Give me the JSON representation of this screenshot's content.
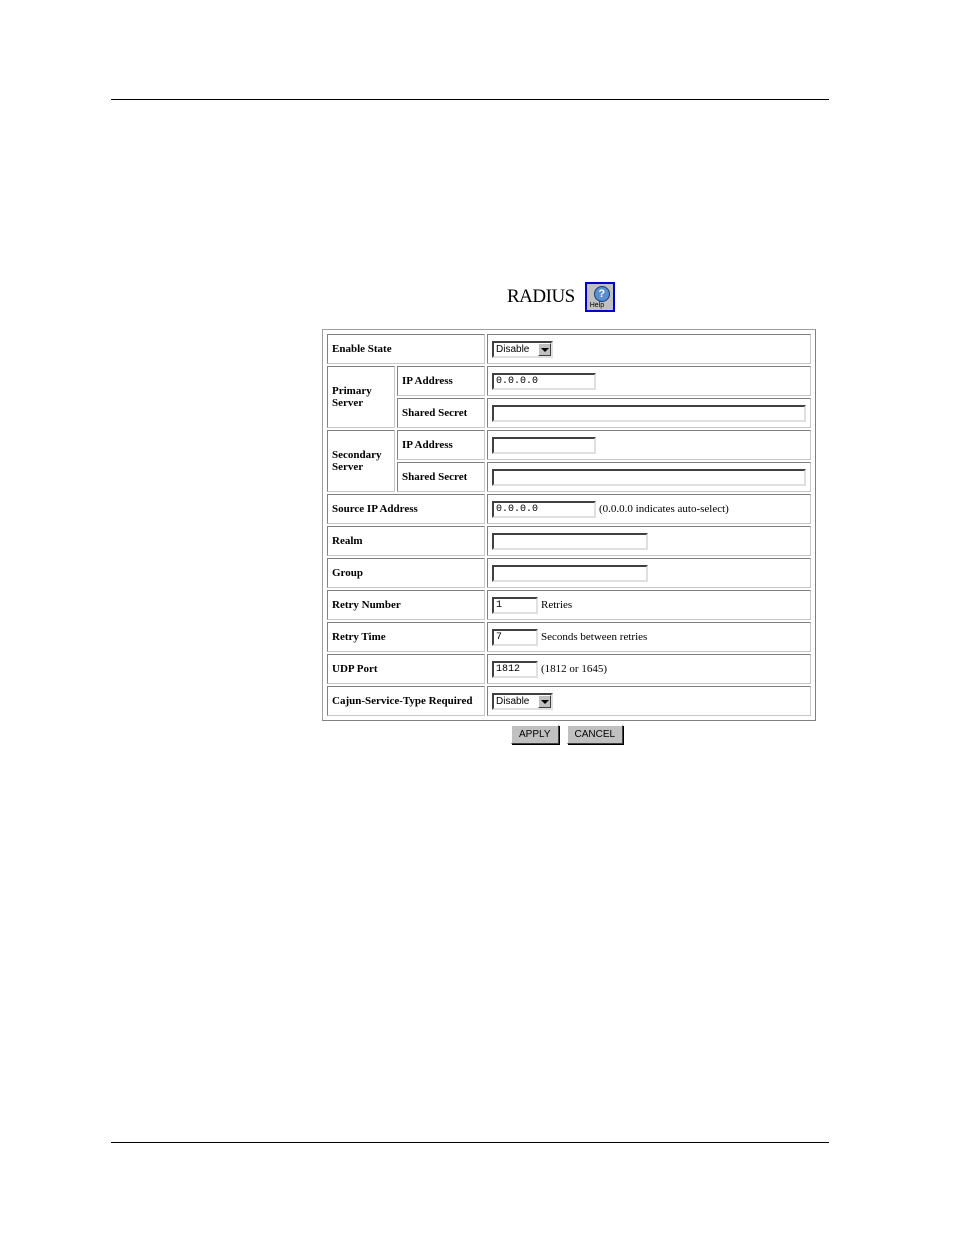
{
  "page": {
    "title": "RADIUS",
    "help_icon": "help-icon",
    "help_label": "Help"
  },
  "form": {
    "enable_state": {
      "label": "Enable State",
      "value": "Disable"
    },
    "primary_server": {
      "label_line1": "Primary",
      "label_line2": "Server",
      "ip_label": "IP Address",
      "ip_value": "0.0.0.0",
      "secret_label": "Shared Secret",
      "secret_value": ""
    },
    "secondary_server": {
      "label_line1": "Secondary",
      "label_line2": "Server",
      "ip_label": "IP Address",
      "ip_value": "",
      "secret_label": "Shared Secret",
      "secret_value": ""
    },
    "source_ip": {
      "label": "Source IP Address",
      "value": "0.0.0.0",
      "hint": "(0.0.0.0 indicates auto-select)"
    },
    "realm": {
      "label": "Realm",
      "value": ""
    },
    "group": {
      "label": "Group",
      "value": ""
    },
    "retry_number": {
      "label": "Retry Number",
      "value": "1",
      "hint": "Retries"
    },
    "retry_time": {
      "label": "Retry Time",
      "value": "7",
      "hint": "Seconds between retries"
    },
    "udp_port": {
      "label": "UDP Port",
      "value": "1812",
      "hint": "(1812 or 1645)"
    },
    "cajun_service_type": {
      "label": "Cajun-Service-Type Required",
      "value": "Disable"
    }
  },
  "buttons": {
    "apply": "APPLY",
    "cancel": "CANCEL"
  }
}
